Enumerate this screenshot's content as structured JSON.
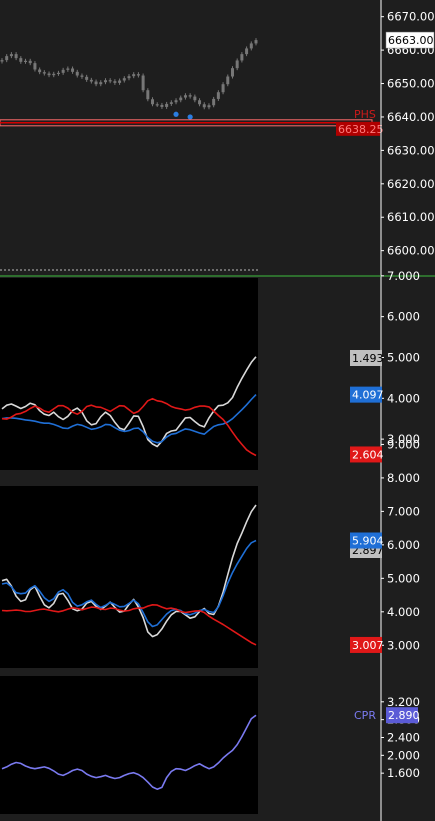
{
  "colors": {
    "background": "#1e1e1e",
    "indicator_bg": "#000000",
    "candles": "#777777",
    "price_flag_bg": "#ffffff",
    "phs_line": "#d40000",
    "phs_band": "#ff6b6b",
    "separator": "#3fbf3f",
    "white_series": "#d9d9d9",
    "blue_series": "#1f6fd6",
    "red_series": "#e01818",
    "cpr_series": "#7a7af0"
  },
  "chart_data": [
    {
      "type": "candlestick",
      "pane": "price",
      "y_ticks": [
        "6670.00",
        "6660.00",
        "6650.00",
        "6640.00",
        "6630.00",
        "6620.00",
        "6610.00",
        "6600.00"
      ],
      "ylim": [
        6599,
        6672
      ],
      "current_price_label": "6663.00",
      "current_price": 6663.0,
      "phs_label": "PHS",
      "phs_value_label": "6638.25",
      "phs_level": 6638.25,
      "close": [
        6657.0,
        6658.2,
        6658.8,
        6657.6,
        6656.5,
        6656.8,
        6656.1,
        6654.2,
        6653.4,
        6653.0,
        6652.5,
        6652.9,
        6653.2,
        6654.1,
        6654.5,
        6653.5,
        6652.4,
        6652.0,
        6651.1,
        6650.6,
        6649.8,
        6650.4,
        6651.0,
        6650.7,
        6650.2,
        6650.9,
        6651.6,
        6652.2,
        6652.8,
        6652.4,
        6648.0,
        6645.3,
        6643.8,
        6643.6,
        6643.0,
        6643.9,
        6644.4,
        6645.0,
        6645.8,
        6646.5,
        6646.1,
        6645.0,
        6643.8,
        6642.9,
        6643.5,
        6645.4,
        6647.4,
        6649.8,
        6652.1,
        6654.6,
        6656.9,
        6658.8,
        6660.5,
        6662.0,
        6663.0
      ],
      "markers": [
        {
          "x": 37,
          "value": 6640.8
        },
        {
          "x": 40,
          "value": 6640.0
        }
      ]
    },
    {
      "type": "line",
      "pane": "indicator-1",
      "y_ticks": [
        "7.000",
        "6.000",
        "5.000",
        "4.000",
        "3.000"
      ],
      "ylim": [
        2.44,
        7.02
      ],
      "series": [
        {
          "label": "1.493",
          "color": "#d9d9d9",
          "values": [
            3.74,
            3.83,
            3.86,
            3.81,
            3.75,
            3.8,
            3.88,
            3.84,
            3.7,
            3.61,
            3.58,
            3.66,
            3.55,
            3.48,
            3.56,
            3.7,
            3.76,
            3.66,
            3.45,
            3.35,
            3.38,
            3.55,
            3.66,
            3.58,
            3.41,
            3.27,
            3.23,
            3.39,
            3.57,
            3.56,
            3.31,
            2.99,
            2.88,
            2.82,
            2.95,
            3.14,
            3.2,
            3.22,
            3.37,
            3.52,
            3.53,
            3.43,
            3.34,
            3.3,
            3.52,
            3.69,
            3.82,
            3.83,
            3.89,
            4.02,
            4.27,
            4.49,
            4.69,
            4.88,
            5.02
          ]
        },
        {
          "label": "4.097",
          "color": "#1f6fd6",
          "values": [
            3.5,
            3.52,
            3.52,
            3.51,
            3.49,
            3.47,
            3.46,
            3.44,
            3.41,
            3.39,
            3.39,
            3.36,
            3.32,
            3.27,
            3.26,
            3.32,
            3.36,
            3.34,
            3.29,
            3.24,
            3.26,
            3.3,
            3.36,
            3.35,
            3.28,
            3.22,
            3.19,
            3.21,
            3.26,
            3.27,
            3.18,
            3.04,
            2.95,
            2.91,
            2.94,
            3.05,
            3.12,
            3.14,
            3.2,
            3.25,
            3.23,
            3.19,
            3.15,
            3.12,
            3.22,
            3.31,
            3.35,
            3.37,
            3.42,
            3.5,
            3.61,
            3.72,
            3.84,
            3.97,
            4.09
          ]
        },
        {
          "label": "2.604",
          "color": "#e01818",
          "values": [
            3.5,
            3.49,
            3.54,
            3.61,
            3.63,
            3.68,
            3.75,
            3.81,
            3.76,
            3.69,
            3.66,
            3.74,
            3.82,
            3.82,
            3.76,
            3.66,
            3.61,
            3.68,
            3.8,
            3.83,
            3.79,
            3.78,
            3.73,
            3.68,
            3.75,
            3.82,
            3.81,
            3.72,
            3.63,
            3.68,
            3.8,
            3.94,
            3.99,
            3.94,
            3.92,
            3.87,
            3.8,
            3.76,
            3.74,
            3.71,
            3.73,
            3.78,
            3.81,
            3.81,
            3.79,
            3.69,
            3.58,
            3.48,
            3.34,
            3.17,
            3.01,
            2.87,
            2.74,
            2.66,
            2.6
          ]
        }
      ]
    },
    {
      "type": "line",
      "pane": "indicator-2",
      "y_ticks": [
        "9.000",
        "8.000",
        "7.000",
        "6.000",
        "5.000",
        "4.000",
        "3.000"
      ],
      "ylim": [
        2.62,
        7.34
      ],
      "series": [
        {
          "label": "2.897",
          "color": "#d9d9d9",
          "values": [
            4.93,
            4.97,
            4.77,
            4.47,
            4.31,
            4.36,
            4.66,
            4.76,
            4.47,
            4.21,
            4.12,
            4.25,
            4.52,
            4.55,
            4.34,
            4.09,
            4.03,
            4.08,
            4.26,
            4.31,
            4.16,
            4.07,
            4.17,
            4.29,
            4.13,
            3.99,
            4.02,
            4.22,
            4.37,
            4.14,
            3.83,
            3.4,
            3.26,
            3.32,
            3.49,
            3.72,
            3.91,
            4.01,
            4.01,
            3.91,
            3.81,
            3.85,
            4.01,
            4.1,
            3.95,
            3.92,
            4.17,
            4.59,
            5.11,
            5.62,
            6.04,
            6.35,
            6.69,
            6.99,
            7.19
          ]
        },
        {
          "label": "5.904",
          "color": "#1f6fd6",
          "values": [
            4.83,
            4.86,
            4.75,
            4.57,
            4.54,
            4.56,
            4.7,
            4.78,
            4.62,
            4.42,
            4.31,
            4.39,
            4.59,
            4.66,
            4.54,
            4.28,
            4.17,
            4.21,
            4.3,
            4.35,
            4.22,
            4.13,
            4.19,
            4.28,
            4.22,
            4.15,
            4.16,
            4.25,
            4.35,
            4.24,
            3.98,
            3.7,
            3.56,
            3.61,
            3.77,
            3.93,
            4.04,
            4.07,
            4.04,
            3.94,
            3.91,
            3.96,
            4.04,
            4.07,
            4.01,
            3.98,
            4.15,
            4.48,
            4.86,
            5.17,
            5.43,
            5.66,
            5.89,
            6.06,
            6.13
          ]
        },
        {
          "label": "3.007",
          "color": "#e01818",
          "values": [
            4.04,
            4.03,
            4.04,
            4.05,
            4.04,
            4.01,
            4.01,
            4.04,
            4.07,
            4.08,
            4.05,
            4.02,
            4.0,
            4.03,
            4.08,
            4.12,
            4.1,
            4.06,
            4.1,
            4.14,
            4.13,
            4.08,
            4.07,
            4.11,
            4.1,
            4.05,
            4.02,
            4.04,
            4.09,
            4.11,
            4.11,
            4.17,
            4.21,
            4.2,
            4.14,
            4.09,
            4.11,
            4.08,
            4.01,
            3.98,
            4.0,
            4.02,
            4.03,
            3.98,
            3.87,
            3.78,
            3.7,
            3.62,
            3.53,
            3.44,
            3.35,
            3.26,
            3.17,
            3.08,
            3.01
          ]
        }
      ]
    },
    {
      "type": "line",
      "pane": "cpr",
      "y_ticks": [
        "3.200",
        "2.800",
        "2.400",
        "2.000",
        "1.600"
      ],
      "ylim": [
        1.2,
        3.42
      ],
      "series": [
        {
          "label": "2.890",
          "color": "#7a7af0",
          "name": "CPR",
          "values": [
            1.7,
            1.74,
            1.8,
            1.84,
            1.82,
            1.76,
            1.72,
            1.7,
            1.72,
            1.74,
            1.71,
            1.65,
            1.58,
            1.55,
            1.6,
            1.66,
            1.69,
            1.66,
            1.58,
            1.53,
            1.5,
            1.52,
            1.55,
            1.51,
            1.48,
            1.5,
            1.55,
            1.59,
            1.61,
            1.57,
            1.5,
            1.4,
            1.29,
            1.24,
            1.28,
            1.5,
            1.64,
            1.7,
            1.69,
            1.66,
            1.71,
            1.77,
            1.81,
            1.75,
            1.7,
            1.74,
            1.83,
            1.94,
            2.03,
            2.11,
            2.24,
            2.42,
            2.62,
            2.82,
            2.9
          ]
        }
      ]
    }
  ]
}
